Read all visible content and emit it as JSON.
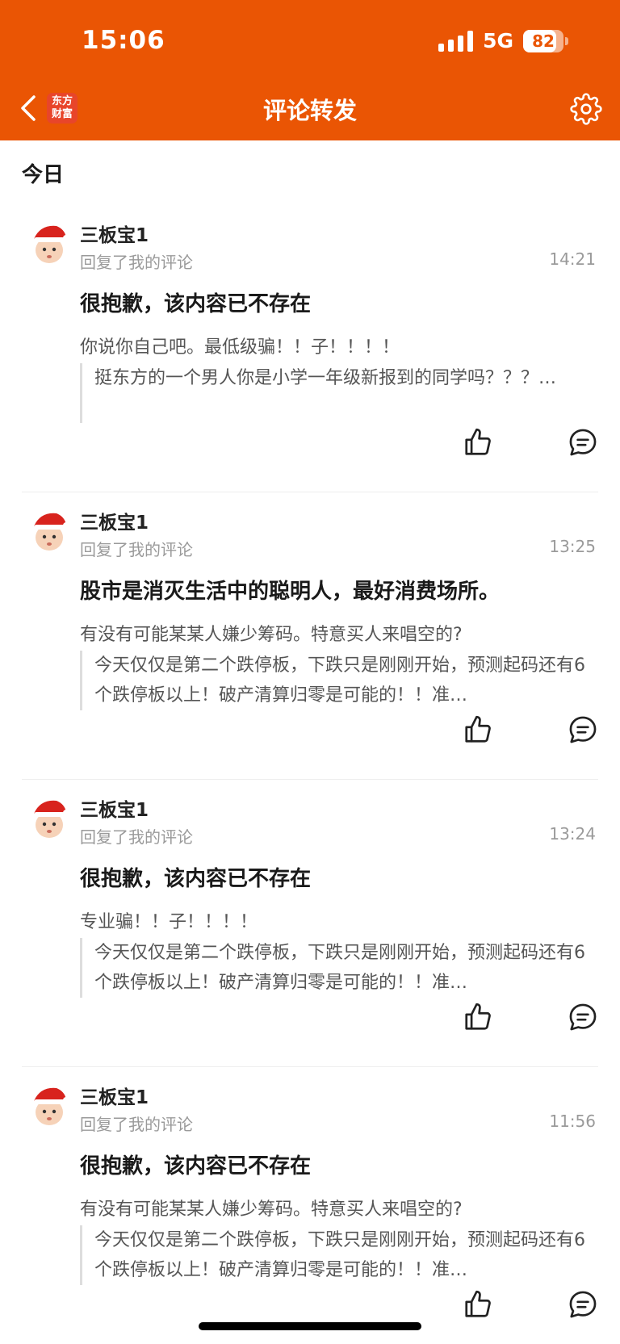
{
  "status_bar": {
    "time": "15:06",
    "network": "5G",
    "battery": "82",
    "battery_level": 0.82,
    "signal_bars": 4
  },
  "nav": {
    "back_icon": "chevron-left-icon",
    "logo_text": "东方财富",
    "title": "评论转发",
    "settings_icon": "gear-icon"
  },
  "section": {
    "title": "今日"
  },
  "colors": {
    "brand": "#ea5504",
    "secondary_text": "#9a9a9a",
    "body_text": "#555555"
  },
  "items": [
    {
      "user": "三板宝1",
      "action": "回复了我的评论",
      "time": "14:21",
      "main": "很抱歉，该内容已不存在",
      "reply": "你说你自己吧。最低级骗！！子！！！！",
      "quote": "挺东方的一个男人你是小学一年级新报到的同学吗？？？…"
    },
    {
      "user": "三板宝1",
      "action": "回复了我的评论",
      "time": "13:25",
      "main": "股市是消灭生活中的聪明人，最好消费场所。",
      "reply": "有没有可能某某人嫌少筹码。特意买人来唱空的?",
      "quote": "今天仅仅是第二个跌停板，下跌只是刚刚开始，预测起码还有6个跌停板以上！破产清算归零是可能的！！准…"
    },
    {
      "user": "三板宝1",
      "action": "回复了我的评论",
      "time": "13:24",
      "main": "很抱歉，该内容已不存在",
      "reply": "专业骗！！子！！！！",
      "quote": "今天仅仅是第二个跌停板，下跌只是刚刚开始，预测起码还有6个跌停板以上！破产清算归零是可能的！！准…"
    },
    {
      "user": "三板宝1",
      "action": "回复了我的评论",
      "time": "11:56",
      "main": "很抱歉，该内容已不存在",
      "reply": "有没有可能某某人嫌少筹码。特意买人来唱空的?",
      "quote": "今天仅仅是第二个跌停板，下跌只是刚刚开始，预测起码还有6个跌停板以上！破产清算归零是可能的！！准…"
    }
  ]
}
